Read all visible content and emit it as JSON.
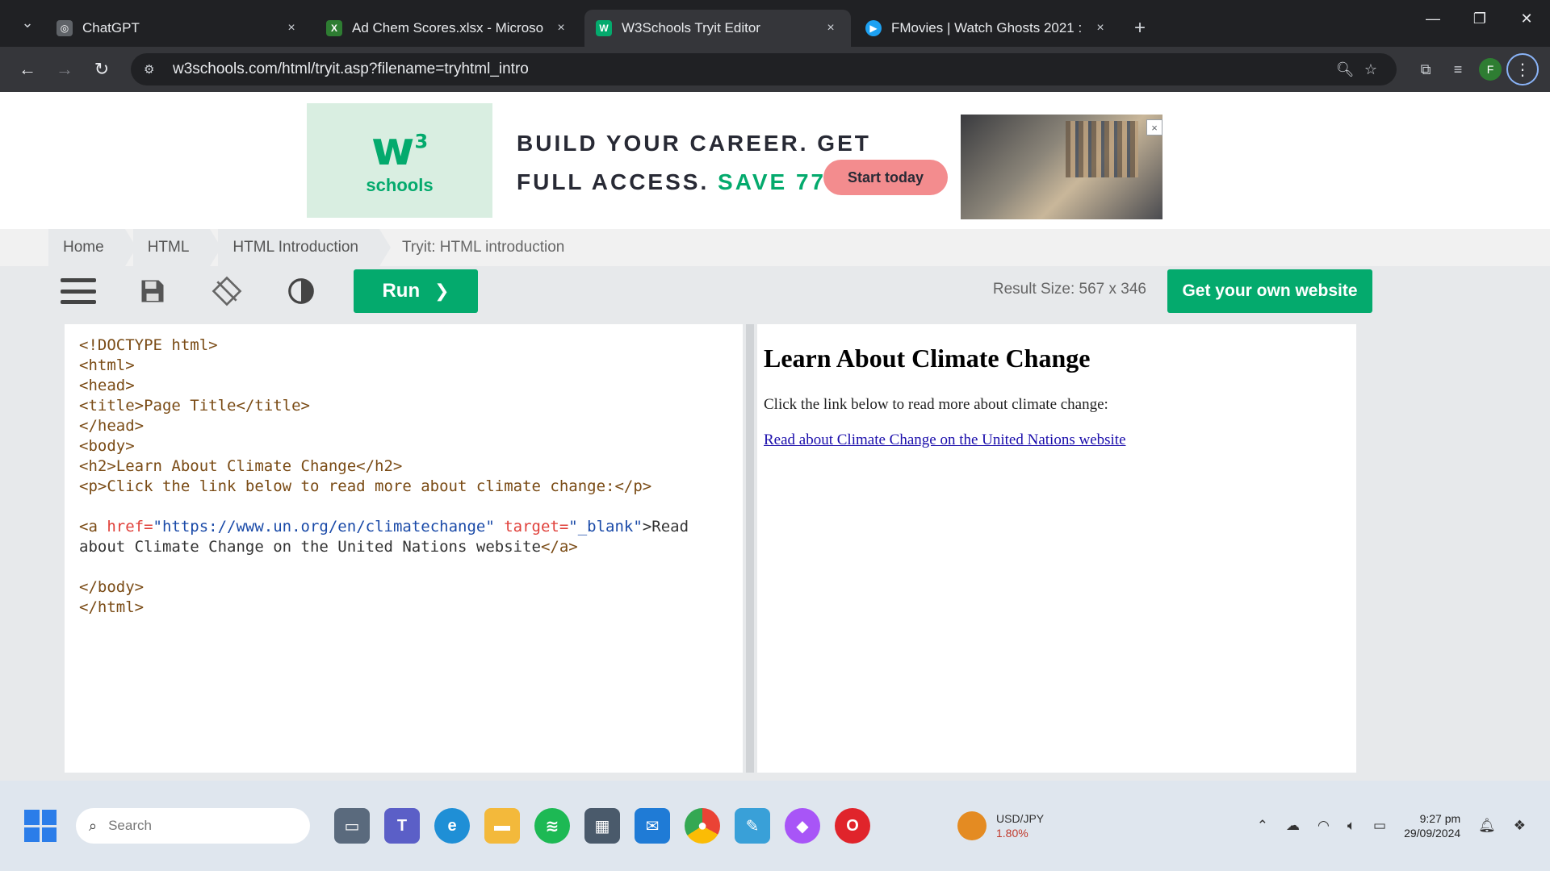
{
  "browser": {
    "tabs": [
      {
        "title": "ChatGPT",
        "close": "×",
        "active": false,
        "favicon": "openai-icon",
        "color": "#5f6368"
      },
      {
        "title": "Ad Chem Scores.xlsx - Microso",
        "close": "×",
        "active": false,
        "favicon": "excel-icon",
        "color": "#2e7d32"
      },
      {
        "title": "W3Schools Tryit Editor",
        "close": "×",
        "active": true,
        "favicon": "w3schools-icon",
        "color": "#04aa6d"
      },
      {
        "title": "FMovies | Watch Ghosts 2021 :",
        "close": "×",
        "active": false,
        "favicon": "play-icon",
        "color": "#1da1f2"
      }
    ],
    "new_tab": "+",
    "url": "w3schools.com/html/tryit.asp?filename=tryhtml_intro",
    "profile_initial": "F"
  },
  "ad": {
    "logo_main": "w",
    "logo_sup": "3",
    "logo_sub": "schools",
    "headline_1": "BUILD YOUR CAREER. GET",
    "headline_2": "FULL ACCESS.",
    "headline_save": "SAVE 770$",
    "cta": "Start today",
    "close": "×"
  },
  "breadcrumb": [
    "Home",
    "HTML",
    "HTML Introduction",
    "Tryit: HTML introduction"
  ],
  "editor": {
    "run_label": "Run",
    "run_chevron": "❯",
    "result_size": "Result Size: 567 x 346",
    "own_website": "Get your own website"
  },
  "code": {
    "l1": "<!DOCTYPE html>",
    "l2": "<html>",
    "l3": "<head>",
    "l4": "<title>Page Title</title>",
    "l5": "</head>",
    "l6": "<body>",
    "l7": "<h2>Learn About Climate Change</h2>",
    "l8": "<p>Click the link below to read more about climate change:</p>",
    "l10_open": "<a ",
    "l10_attr1": "href=",
    "l10_val1": "\"https://www.un.org/en/climatechange\"",
    "l10_attr2": " target=",
    "l10_val2": "\"_blank\"",
    "l10_text": ">Read",
    "l11_text": "about Climate Change on the United Nations website",
    "l11_close": "</a>",
    "l13": "</body>",
    "l14": "</html>"
  },
  "result": {
    "heading": "Learn About Climate Change",
    "paragraph": "Click the link below to read more about climate change:",
    "link": "Read about Climate Change on the United Nations website"
  },
  "taskbar": {
    "search_placeholder": "Search",
    "ticker": "USD/JPY",
    "ticker_change": "1.80%",
    "time": "9:27 pm",
    "date": "29/09/2024"
  }
}
